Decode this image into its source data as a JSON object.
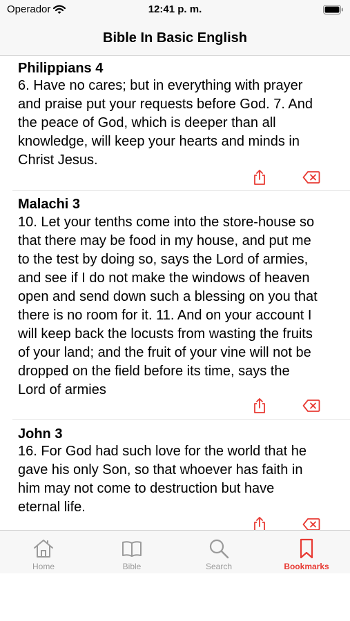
{
  "status_bar": {
    "carrier": "Operador",
    "time": "12:41 p. m."
  },
  "nav": {
    "title": "Bible In Basic English"
  },
  "bookmarks": [
    {
      "reference": "Philippians 4",
      "lines": [
        "6. Have no cares; but in everything with prayer",
        "and praise put your requests before God. 7. And",
        "the peace of God, which is deeper than all",
        "knowledge, will keep your hearts and minds in",
        "Christ Jesus."
      ]
    },
    {
      "reference": "Malachi 3",
      "lines": [
        "10. Let your tenths come into the store-house so",
        "that there may be food in my house, and put me",
        "to the test by doing so, says the Lord of armies,",
        "and see if I do not make the windows of heaven",
        "open and send down such a blessing on you that",
        "there is no room for it. 11. And on your account I",
        "will keep back the locusts from wasting the fruits",
        "of your land; and the fruit of your vine will not be",
        "dropped on the field before its time, says the",
        "Lord of armies"
      ]
    },
    {
      "reference": "John 3",
      "lines": [
        "16. For God had such love for the world that he",
        "gave his only Son, so that whoever has faith in",
        "him may not come to destruction but have",
        "eternal life."
      ]
    }
  ],
  "tabs": [
    {
      "label": "Home",
      "icon": "house-icon"
    },
    {
      "label": "Bible",
      "icon": "book-icon"
    },
    {
      "label": "Search",
      "icon": "magnifier-icon"
    },
    {
      "label": "Bookmarks",
      "icon": "bookmark-icon"
    }
  ],
  "active_tab": "Bookmarks",
  "colors": {
    "accent": "#e83a33",
    "inactive": "#9a9a9a",
    "bar_bg": "#f7f7f7"
  }
}
